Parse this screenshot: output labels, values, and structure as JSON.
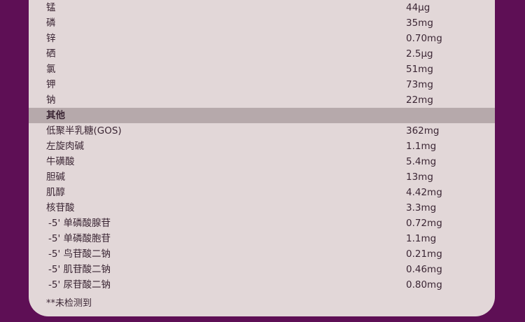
{
  "minerals_tail": [
    {
      "name": "锰",
      "value": "44μg"
    },
    {
      "name": "磷",
      "value": "35mg"
    },
    {
      "name": "锌",
      "value": "0.70mg"
    },
    {
      "name": "硒",
      "value": "2.5μg"
    },
    {
      "name": "氯",
      "value": "51mg"
    },
    {
      "name": "钾",
      "value": "73mg"
    },
    {
      "name": "钠",
      "value": "22mg"
    }
  ],
  "other_section": {
    "title": "其他",
    "items": [
      {
        "name": "低聚半乳糖(GOS)",
        "value": "362mg"
      },
      {
        "name": "左旋肉碱",
        "value": "1.1mg"
      },
      {
        "name": "牛磺酸",
        "value": "5.4mg"
      },
      {
        "name": "胆碱",
        "value": "13mg"
      },
      {
        "name": "肌醇",
        "value": "4.42mg"
      },
      {
        "name": "核苷酸",
        "value": "3.3mg"
      },
      {
        "name": "-5' 单磷酸腺苷",
        "value": "0.72mg"
      },
      {
        "name": "-5' 单磷酸胞苷",
        "value": "1.1mg"
      },
      {
        "name": "-5' 鸟苷酸二钠",
        "value": "0.21mg"
      },
      {
        "name": "-5' 肌苷酸二钠",
        "value": "0.46mg"
      },
      {
        "name": "-5' 尿苷酸二钠",
        "value": "0.80mg"
      }
    ]
  },
  "footnote": "**未检测到",
  "colors": {
    "background": "#5e0f55",
    "panel": "#e2d7d8",
    "section_band": "#b6a9ab",
    "text": "#3b2634"
  }
}
